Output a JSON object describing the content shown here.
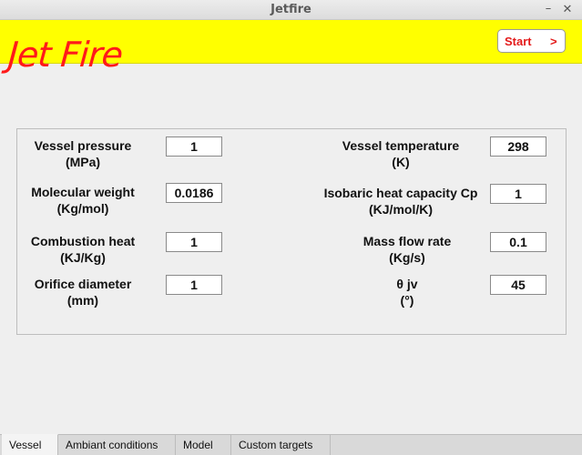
{
  "window": {
    "title": "Jetfire",
    "minimize_glyph": "–",
    "close_glyph": "✕"
  },
  "banner": {
    "logo_text": "Jet Fire",
    "start_label": "Start",
    "start_arrow": ">"
  },
  "fields": {
    "vessel_pressure": {
      "label": "Vessel pressure",
      "unit": "(MPa)",
      "value": "1"
    },
    "molecular_weight": {
      "label": "Molecular weight",
      "unit": "(Kg/mol)",
      "value": "0.0186"
    },
    "combustion_heat": {
      "label": "Combustion heat",
      "unit": "(KJ/Kg)",
      "value": "1"
    },
    "orifice_diameter": {
      "label": "Orifice diameter",
      "unit": "(mm)",
      "value": "1"
    },
    "vessel_temperature": {
      "label": "Vessel temperature",
      "unit": "(K)",
      "value": "298"
    },
    "isobaric_heat_capacity": {
      "label": "Isobaric heat capacity Cp",
      "unit": "(KJ/mol/K)",
      "value": "1"
    },
    "mass_flow_rate": {
      "label": "Mass flow rate",
      "unit": "(Kg/s)",
      "value": "0.1"
    },
    "theta_jv": {
      "label": "θ jv",
      "unit": "(°)",
      "value": "45"
    }
  },
  "tabs": [
    "Vessel",
    "Ambiant conditions",
    "Model",
    "Custom targets"
  ],
  "colors": {
    "banner": "#ffff00",
    "logo": "#ff1a1a",
    "start_text": "#e31a1a"
  }
}
